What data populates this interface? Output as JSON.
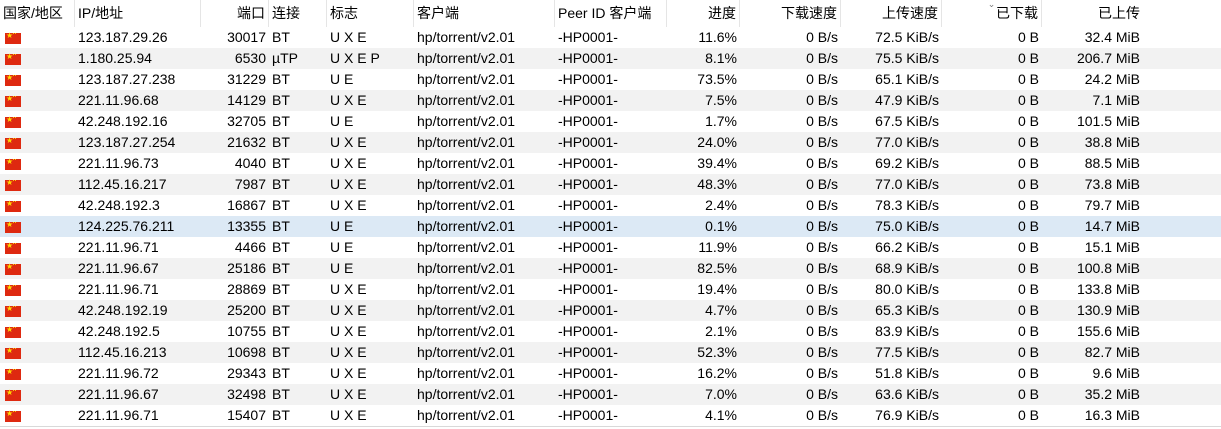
{
  "columns": {
    "country": "国家/地区",
    "ip": "IP/地址",
    "port": "端口",
    "connection": "连接",
    "flags": "标志",
    "client": "客户端",
    "peer_id_client": "Peer ID 客户端",
    "progress": "进度",
    "down_speed": "下载速度",
    "up_speed": "上传速度",
    "downloaded": "已下载",
    "uploaded": "已上传"
  },
  "sort_indicator_icon": "sort-caret-icon",
  "flag_icon": "china-flag-icon",
  "rows": [
    {
      "ip": "123.187.29.26",
      "port": "30017",
      "connection": "BT",
      "flags": "U X E",
      "client": "hp/torrent/v2.01",
      "peer_id_client": "-HP0001-",
      "progress": "11.6%",
      "down_speed": "0 B/s",
      "up_speed": "72.5 KiB/s",
      "downloaded": "0 B",
      "uploaded": "32.4 MiB"
    },
    {
      "ip": "1.180.25.94",
      "port": "6530",
      "connection": "µTP",
      "flags": "U X E P",
      "client": "hp/torrent/v2.01",
      "peer_id_client": "-HP0001-",
      "progress": "8.1%",
      "down_speed": "0 B/s",
      "up_speed": "75.5 KiB/s",
      "downloaded": "0 B",
      "uploaded": "206.7 MiB"
    },
    {
      "ip": "123.187.27.238",
      "port": "31229",
      "connection": "BT",
      "flags": "U E",
      "client": "hp/torrent/v2.01",
      "peer_id_client": "-HP0001-",
      "progress": "73.5%",
      "down_speed": "0 B/s",
      "up_speed": "65.1 KiB/s",
      "downloaded": "0 B",
      "uploaded": "24.2 MiB"
    },
    {
      "ip": "221.11.96.68",
      "port": "14129",
      "connection": "BT",
      "flags": "U X E",
      "client": "hp/torrent/v2.01",
      "peer_id_client": "-HP0001-",
      "progress": "7.5%",
      "down_speed": "0 B/s",
      "up_speed": "47.9 KiB/s",
      "downloaded": "0 B",
      "uploaded": "7.1 MiB"
    },
    {
      "ip": "42.248.192.16",
      "port": "32705",
      "connection": "BT",
      "flags": "U E",
      "client": "hp/torrent/v2.01",
      "peer_id_client": "-HP0001-",
      "progress": "1.7%",
      "down_speed": "0 B/s",
      "up_speed": "67.5 KiB/s",
      "downloaded": "0 B",
      "uploaded": "101.5 MiB"
    },
    {
      "ip": "123.187.27.254",
      "port": "21632",
      "connection": "BT",
      "flags": "U X E",
      "client": "hp/torrent/v2.01",
      "peer_id_client": "-HP0001-",
      "progress": "24.0%",
      "down_speed": "0 B/s",
      "up_speed": "77.0 KiB/s",
      "downloaded": "0 B",
      "uploaded": "38.8 MiB"
    },
    {
      "ip": "221.11.96.73",
      "port": "4040",
      "connection": "BT",
      "flags": "U X E",
      "client": "hp/torrent/v2.01",
      "peer_id_client": "-HP0001-",
      "progress": "39.4%",
      "down_speed": "0 B/s",
      "up_speed": "69.2 KiB/s",
      "downloaded": "0 B",
      "uploaded": "88.5 MiB"
    },
    {
      "ip": "112.45.16.217",
      "port": "7987",
      "connection": "BT",
      "flags": "U X E",
      "client": "hp/torrent/v2.01",
      "peer_id_client": "-HP0001-",
      "progress": "48.3%",
      "down_speed": "0 B/s",
      "up_speed": "77.0 KiB/s",
      "downloaded": "0 B",
      "uploaded": "73.8 MiB"
    },
    {
      "ip": "42.248.192.3",
      "port": "16867",
      "connection": "BT",
      "flags": "U X E",
      "client": "hp/torrent/v2.01",
      "peer_id_client": "-HP0001-",
      "progress": "2.4%",
      "down_speed": "0 B/s",
      "up_speed": "78.3 KiB/s",
      "downloaded": "0 B",
      "uploaded": "79.7 MiB"
    },
    {
      "ip": "124.225.76.211",
      "port": "13355",
      "connection": "BT",
      "flags": "U E",
      "client": "hp/torrent/v2.01",
      "peer_id_client": "-HP0001-",
      "progress": "0.1%",
      "down_speed": "0 B/s",
      "up_speed": "75.0 KiB/s",
      "downloaded": "0 B",
      "uploaded": "14.7 MiB",
      "selected": true
    },
    {
      "ip": "221.11.96.71",
      "port": "4466",
      "connection": "BT",
      "flags": "U E",
      "client": "hp/torrent/v2.01",
      "peer_id_client": "-HP0001-",
      "progress": "11.9%",
      "down_speed": "0 B/s",
      "up_speed": "66.2 KiB/s",
      "downloaded": "0 B",
      "uploaded": "15.1 MiB"
    },
    {
      "ip": "221.11.96.67",
      "port": "25186",
      "connection": "BT",
      "flags": "U E",
      "client": "hp/torrent/v2.01",
      "peer_id_client": "-HP0001-",
      "progress": "82.5%",
      "down_speed": "0 B/s",
      "up_speed": "68.9 KiB/s",
      "downloaded": "0 B",
      "uploaded": "100.8 MiB"
    },
    {
      "ip": "221.11.96.71",
      "port": "28869",
      "connection": "BT",
      "flags": "U X E",
      "client": "hp/torrent/v2.01",
      "peer_id_client": "-HP0001-",
      "progress": "19.4%",
      "down_speed": "0 B/s",
      "up_speed": "80.0 KiB/s",
      "downloaded": "0 B",
      "uploaded": "133.8 MiB"
    },
    {
      "ip": "42.248.192.19",
      "port": "25200",
      "connection": "BT",
      "flags": "U X E",
      "client": "hp/torrent/v2.01",
      "peer_id_client": "-HP0001-",
      "progress": "4.7%",
      "down_speed": "0 B/s",
      "up_speed": "65.3 KiB/s",
      "downloaded": "0 B",
      "uploaded": "130.9 MiB"
    },
    {
      "ip": "42.248.192.5",
      "port": "10755",
      "connection": "BT",
      "flags": "U X E",
      "client": "hp/torrent/v2.01",
      "peer_id_client": "-HP0001-",
      "progress": "2.1%",
      "down_speed": "0 B/s",
      "up_speed": "83.9 KiB/s",
      "downloaded": "0 B",
      "uploaded": "155.6 MiB"
    },
    {
      "ip": "112.45.16.213",
      "port": "10698",
      "connection": "BT",
      "flags": "U X E",
      "client": "hp/torrent/v2.01",
      "peer_id_client": "-HP0001-",
      "progress": "52.3%",
      "down_speed": "0 B/s",
      "up_speed": "77.5 KiB/s",
      "downloaded": "0 B",
      "uploaded": "82.7 MiB"
    },
    {
      "ip": "221.11.96.72",
      "port": "29343",
      "connection": "BT",
      "flags": "U X E",
      "client": "hp/torrent/v2.01",
      "peer_id_client": "-HP0001-",
      "progress": "16.2%",
      "down_speed": "0 B/s",
      "up_speed": "51.8 KiB/s",
      "downloaded": "0 B",
      "uploaded": "9.6 MiB"
    },
    {
      "ip": "221.11.96.67",
      "port": "32498",
      "connection": "BT",
      "flags": "U X E",
      "client": "hp/torrent/v2.01",
      "peer_id_client": "-HP0001-",
      "progress": "7.0%",
      "down_speed": "0 B/s",
      "up_speed": "63.6 KiB/s",
      "downloaded": "0 B",
      "uploaded": "35.2 MiB"
    },
    {
      "ip": "221.11.96.71",
      "port": "15407",
      "connection": "BT",
      "flags": "U X E",
      "client": "hp/torrent/v2.01",
      "peer_id_client": "-HP0001-",
      "progress": "4.1%",
      "down_speed": "0 B/s",
      "up_speed": "76.9 KiB/s",
      "downloaded": "0 B",
      "uploaded": "16.3 MiB"
    }
  ]
}
